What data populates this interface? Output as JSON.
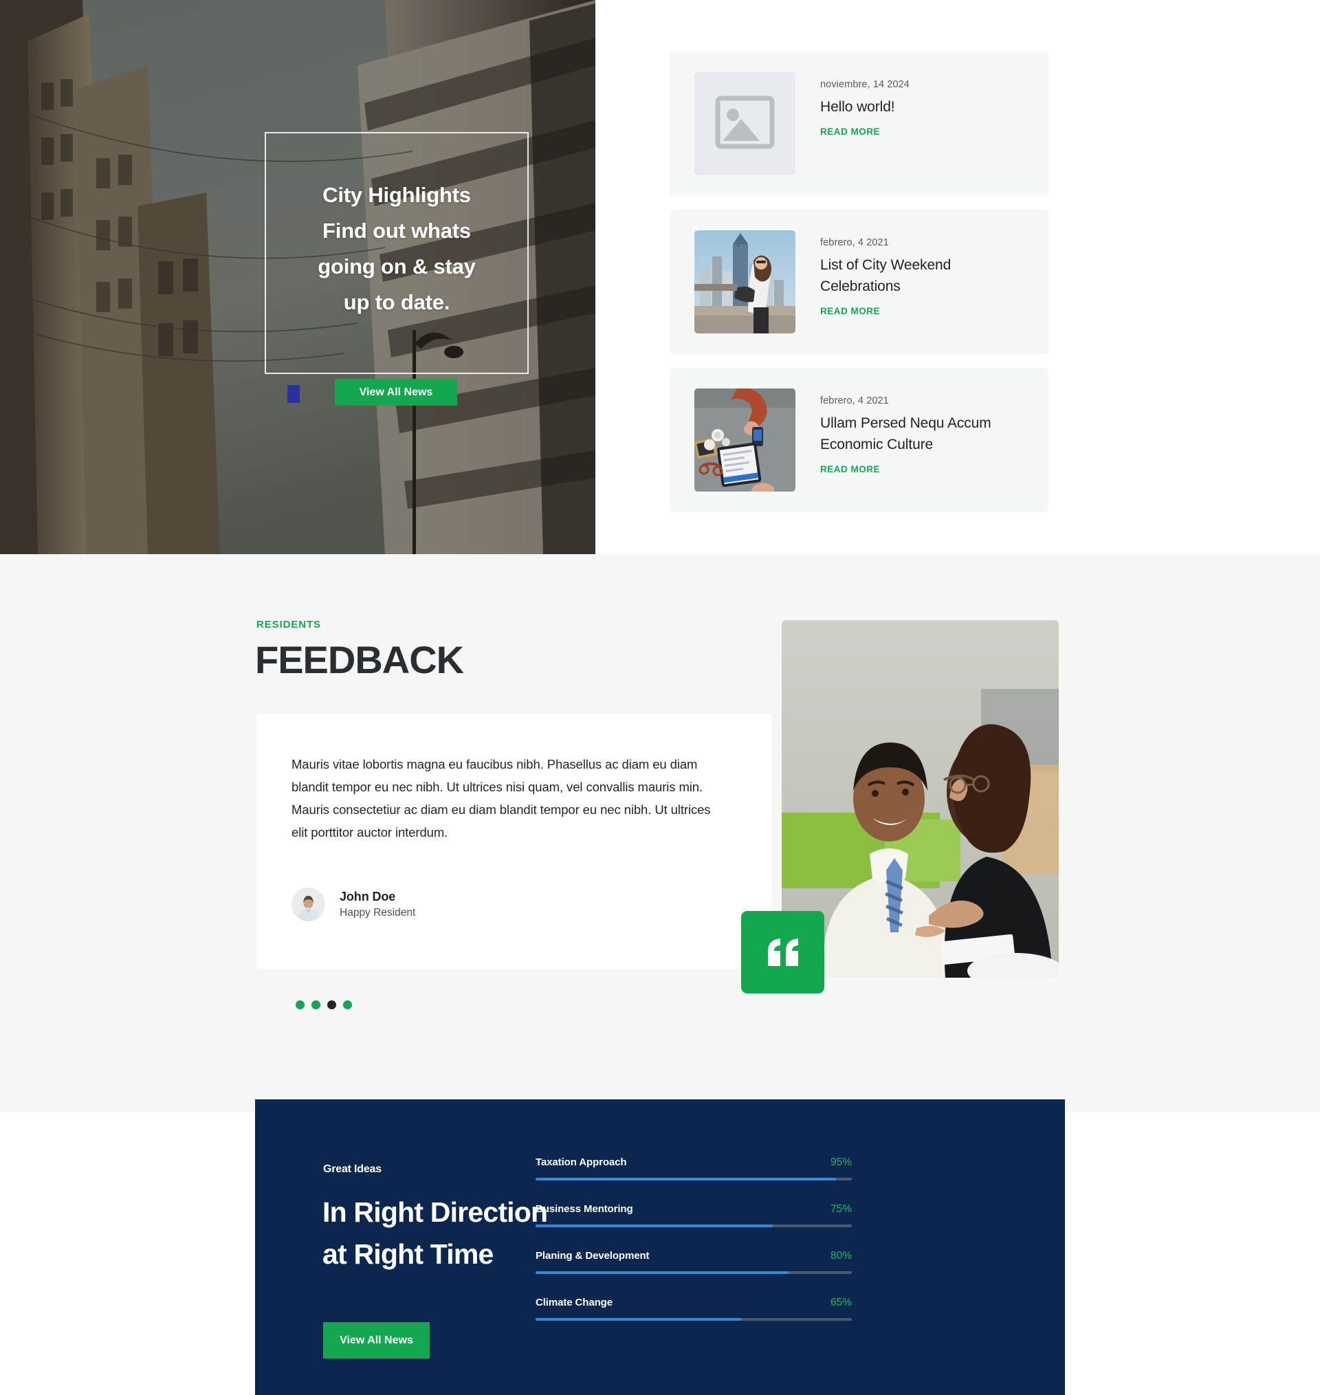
{
  "hero": {
    "title_lines": [
      "City Highlights",
      "Find out whats",
      "going on & stay",
      "up to date."
    ],
    "button_label": "View All News"
  },
  "news": {
    "items": [
      {
        "date": "noviembre, 14 2024",
        "title": "Hello world!",
        "read_more": "READ MORE",
        "thumb": "placeholder-image-icon"
      },
      {
        "date": "febrero, 4 2021",
        "title": "List of City Weekend Celebrations",
        "read_more": "READ MORE",
        "thumb": "woman-city-skyline-photo"
      },
      {
        "date": "febrero, 4 2021",
        "title": "Ullam Persed Nequ Accum Economic Culture",
        "read_more": "READ MORE",
        "thumb": "desk-tablet-topdown-photo"
      }
    ]
  },
  "feedback": {
    "eyebrow": "RESIDENTS",
    "heading": "FEEDBACK",
    "quote": "Mauris vitae lobortis magna eu faucibus nibh. Phasellus ac diam eu diam blandit tempor eu nec nibh. Ut ultrices nisi quam, vel convallis mauris min. Mauris consectetiur ac diam eu diam blandit tempor eu nec nibh. Ut ultrices elit porttitor auctor interdum.",
    "author_name": "John Doe",
    "author_role": "Happy Resident",
    "dots": [
      {
        "active": false
      },
      {
        "active": false
      },
      {
        "active": true
      },
      {
        "active": false
      }
    ],
    "quote_badge_icon": "quote-mark-icon",
    "photo": "two-colleagues-talking-photo"
  },
  "cta": {
    "eyebrow": "Great Ideas",
    "heading_lines": [
      "In Right Direction",
      "at Right Time"
    ],
    "button_label": "View All News"
  },
  "chart_data": {
    "type": "bar",
    "title": "",
    "categories": [
      "Taxation Approach",
      "Business Mentoring",
      "Planing & Development",
      "Climate Change"
    ],
    "values": [
      95,
      75,
      80,
      65
    ],
    "value_labels": [
      "95%",
      "75%",
      "80%",
      "65%"
    ],
    "xlabel": "",
    "ylabel": "",
    "ylim": [
      0,
      100
    ],
    "orientation": "horizontal",
    "grid": false,
    "legend": "none"
  },
  "colors": {
    "green": "#13a750",
    "navy": "#0b2750",
    "bar_fill": "#3a85dd",
    "bar_track": "#4a5a72",
    "pct_green": "#1fb366",
    "card_bg": "#f6f7f7",
    "section_bg": "#f6f6f7",
    "dot_active": "#232629"
  }
}
